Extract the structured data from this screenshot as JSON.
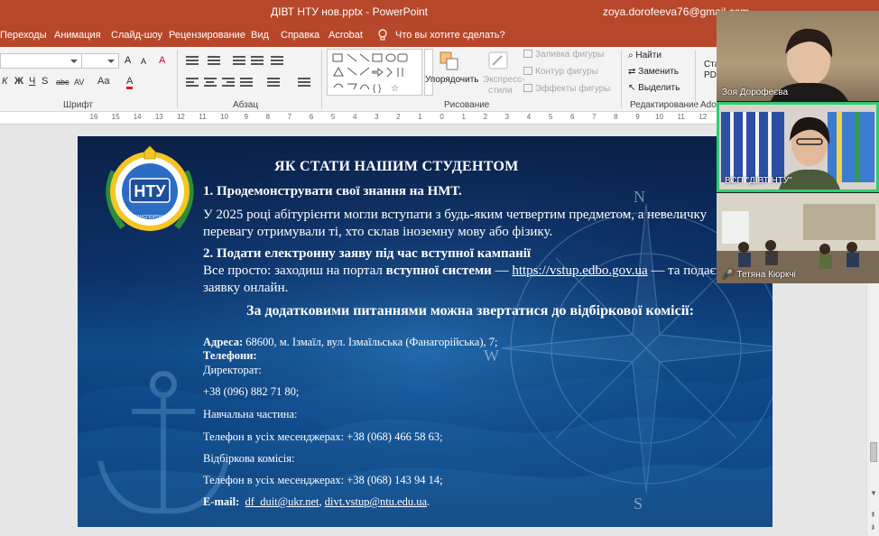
{
  "titlebar": {
    "document_title": "ДІВТ НТУ нов.pptx  -  PowerPoint",
    "user_email": "zoya.dorofeeva76@gmail.com"
  },
  "tabs": {
    "items": [
      "Переходы",
      "Анимация",
      "Слайд-шоу",
      "Рецензирование",
      "Вид",
      "Справка",
      "Acrobat"
    ],
    "tell_me": "Что вы хотите сделать?"
  },
  "ribbon": {
    "font_group": "Шрифт",
    "paragraph_group": "Абзац",
    "drawing_group": "Рисование",
    "editing_group": "Редактирование",
    "arrange": "Упорядочить",
    "quick_styles_1": "Экспресс-",
    "quick_styles_2": "стили",
    "shape_fill": "Заливка фигуры",
    "shape_outline": "Контур фигуры",
    "shape_effects": "Эффекты фигуры",
    "find": "Найти",
    "replace": "Заменить",
    "select": "Выделить",
    "cut_label_1": "Стат",
    "cut_label_2": "PDF",
    "cut_label_3": "Adob",
    "format_letters": {
      "italic": "К",
      "bold": "Ж",
      "underline": "Ч",
      "strike": "S",
      "abc": "abc",
      "spacing": "AV",
      "case": "Aa",
      "grow": "A",
      "shrink": "A",
      "clear": "A",
      "color": "A"
    }
  },
  "ruler": {
    "labels": [
      "16",
      "15",
      "14",
      "13",
      "12",
      "11",
      "10",
      "9",
      "8",
      "7",
      "6",
      "5",
      "4",
      "3",
      "2",
      "1",
      "0",
      "1",
      "2",
      "3",
      "4",
      "5",
      "6",
      "7",
      "8",
      "9",
      "10",
      "11",
      "12",
      "13",
      "14",
      "15",
      "16"
    ]
  },
  "slide": {
    "logo_text": "НТУ",
    "logo_ring_text": "ТРАНСПОРТНИЙ",
    "title": "ЯК СТАТИ НАШИМ СТУДЕНТОМ",
    "step1_heading": "1. Продемонструвати свої знання на НМТ.",
    "step1_line1": "У 2025 році абітурієнти могли вступати з будь-яким четвертим предметом, а невеличку",
    "step1_line2": "перевагу отримували ті, хто склав іноземну мову або фізику.",
    "step2_heading": "2. Подати електронну заяву під час вступної кампанії",
    "step2_line1_a": "Все просто: заходиш на портал ",
    "step2_line1_b": "вступної системи",
    "step2_line1_c": " — ",
    "step2_link": "https://vstup.edbo.gov.ua",
    "step2_line1_d": " — та подаєш",
    "step2_line2": "заявку онлайн.",
    "contact_heading": "За додатковими питаннями можна звертатися до відбіркової комісії:",
    "address_label": "Адреса:",
    "address_value": " 68600, м. Ізмаїл, вул. Ізмаїльська (Фанагорійська), 7;",
    "phones_label": "Телефони:",
    "directorate_label": "Директорат:",
    "directorate_phone": "+38 (096) 882 71 80;",
    "study_label": "Навчальна частина:",
    "study_phone": "Телефон в усіх месенджерах: +38 (068) 466 58 63;",
    "commission_label": "Відбіркова комісія:",
    "commission_phone": "Телефон в усіх месенджерах: +38 (068) 143 94 14;",
    "email_label": "E-mail:",
    "email_1": "df_duit@ukr.net",
    "email_sep": ", ",
    "email_2": "divt.vstup@ntu.edu.ua",
    "email_end": ".",
    "compass_n": "N",
    "compass_w": "W",
    "compass_s": "S"
  },
  "video_call": {
    "participants": [
      {
        "name": "Зоя Дорофеєва",
        "muted": false
      },
      {
        "name": "ВСП \"ДІВТ НТУ\"",
        "muted": false
      },
      {
        "name": "Тетяна Кюркчі",
        "muted": true
      }
    ],
    "active_speaker_color": "#2ecc71"
  },
  "colors": {
    "ribbon_accent": "#b7472a",
    "slide_text": "#ffffff"
  }
}
